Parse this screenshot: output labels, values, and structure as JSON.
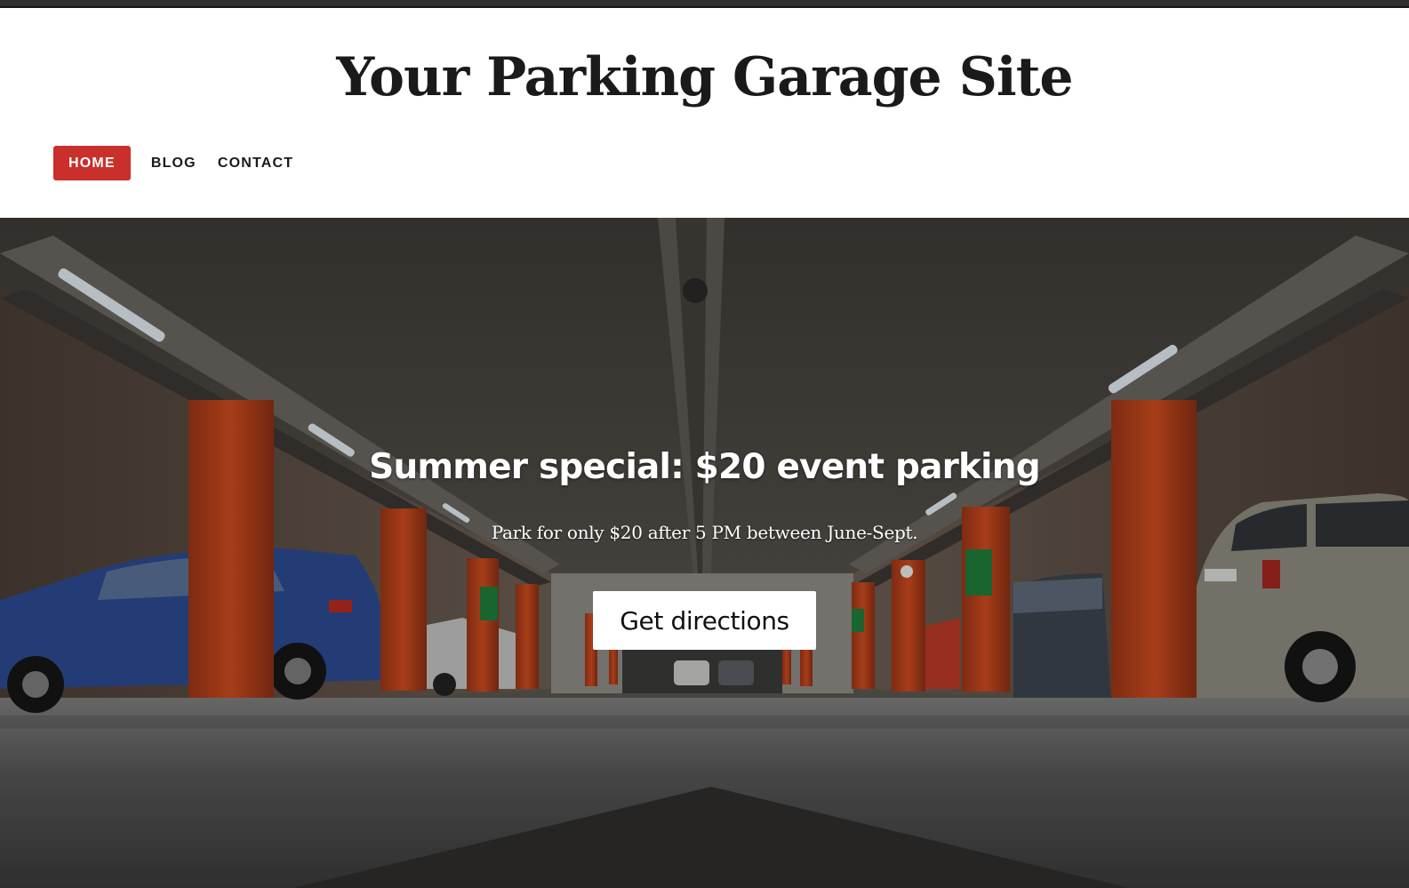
{
  "site": {
    "title": "Your Parking Garage Site"
  },
  "nav": {
    "items": [
      {
        "label": "HOME",
        "active": true
      },
      {
        "label": "BLOG",
        "active": false
      },
      {
        "label": "CONTACT",
        "active": false
      }
    ]
  },
  "hero": {
    "heading": "Summer special: $20 event parking",
    "subheading": "Park for only $20 after 5 PM between June-Sept.",
    "button_label": "Get directions"
  },
  "colors": {
    "accent": "#c9302c",
    "pillar": "#c2461f",
    "text_dark": "#1a1a1a"
  }
}
